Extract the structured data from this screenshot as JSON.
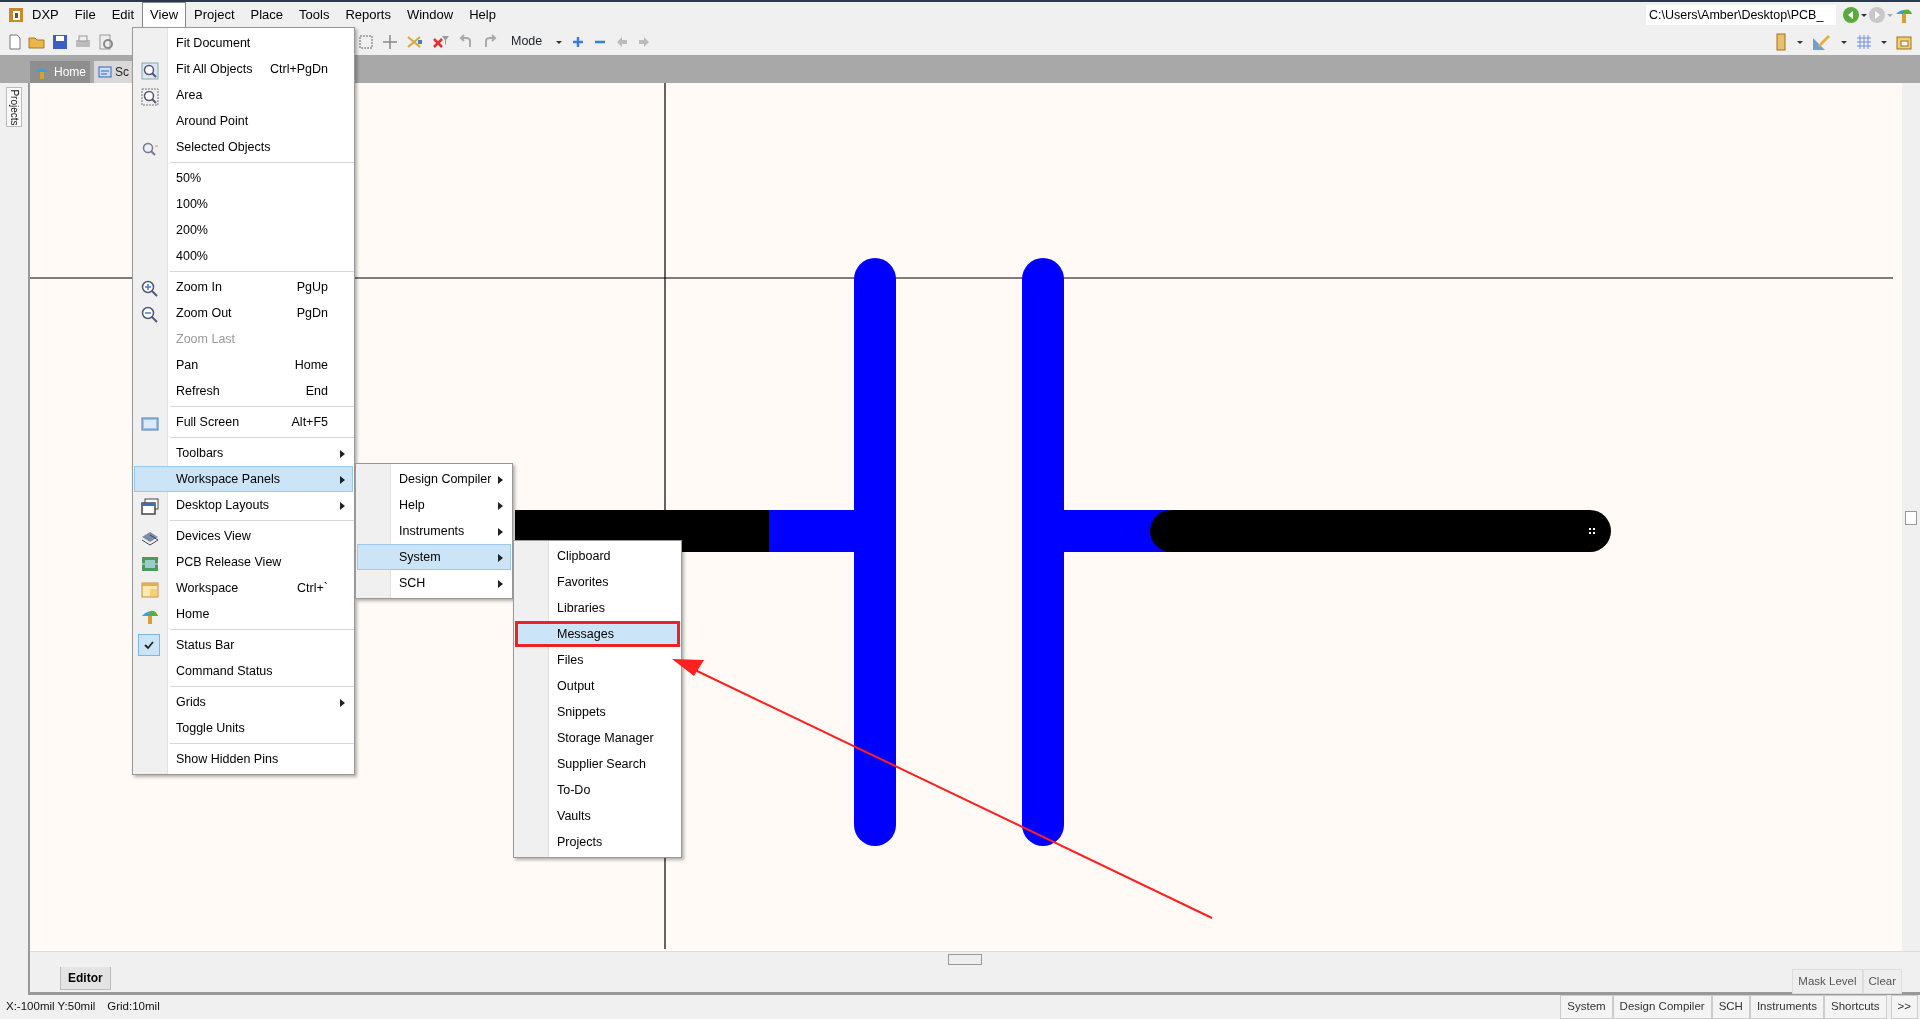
{
  "menubar": [
    {
      "label": "DXP",
      "selected": false
    },
    {
      "label": "File",
      "selected": false
    },
    {
      "label": "Edit",
      "selected": false
    },
    {
      "label": "View",
      "selected": true
    },
    {
      "label": "Project",
      "selected": false
    },
    {
      "label": "Place",
      "selected": false
    },
    {
      "label": "Tools",
      "selected": false
    },
    {
      "label": "Reports",
      "selected": false
    },
    {
      "label": "Window",
      "selected": false
    },
    {
      "label": "Help",
      "selected": false
    }
  ],
  "path_field": {
    "value": "C:\\Users\\Amber\\Desktop\\PCB_"
  },
  "toolbar": {
    "mode_label": "Mode"
  },
  "doc_tabs": [
    {
      "label": "Home",
      "selected": false
    },
    {
      "label": "Sc",
      "selected": true
    }
  ],
  "side_panel": {
    "label": "Projects"
  },
  "view_menu": {
    "items": [
      {
        "kind": "item",
        "label": "Fit Document",
        "selected": false,
        "disabled": false,
        "checked": false,
        "submenu": false
      },
      {
        "kind": "item",
        "label": "Fit All Objects",
        "shortcut": "Ctrl+PgDn",
        "selected": false,
        "disabled": false,
        "checked": false,
        "submenu": false
      },
      {
        "kind": "item",
        "label": "Area",
        "selected": false,
        "disabled": false,
        "checked": false,
        "submenu": false
      },
      {
        "kind": "item",
        "label": "Around Point",
        "selected": false,
        "disabled": false,
        "checked": false,
        "submenu": false
      },
      {
        "kind": "item",
        "label": "Selected Objects",
        "selected": false,
        "disabled": false,
        "checked": false,
        "submenu": false
      },
      {
        "kind": "separator"
      },
      {
        "kind": "item",
        "label": "50%",
        "selected": false,
        "disabled": false,
        "checked": false,
        "submenu": false
      },
      {
        "kind": "item",
        "label": "100%",
        "selected": false,
        "disabled": false,
        "checked": false,
        "submenu": false
      },
      {
        "kind": "item",
        "label": "200%",
        "selected": false,
        "disabled": false,
        "checked": false,
        "submenu": false
      },
      {
        "kind": "item",
        "label": "400%",
        "selected": false,
        "disabled": false,
        "checked": false,
        "submenu": false
      },
      {
        "kind": "separator"
      },
      {
        "kind": "item",
        "label": "Zoom In",
        "shortcut": "PgUp",
        "selected": false,
        "disabled": false,
        "checked": false,
        "submenu": false
      },
      {
        "kind": "item",
        "label": "Zoom Out",
        "shortcut": "PgDn",
        "selected": false,
        "disabled": false,
        "checked": false,
        "submenu": false
      },
      {
        "kind": "item",
        "label": "Zoom Last",
        "selected": false,
        "disabled": true,
        "checked": false,
        "submenu": false
      },
      {
        "kind": "item",
        "label": "Pan",
        "shortcut": "Home",
        "selected": false,
        "disabled": false,
        "checked": false,
        "submenu": false
      },
      {
        "kind": "item",
        "label": "Refresh",
        "shortcut": "End",
        "selected": false,
        "disabled": false,
        "checked": false,
        "submenu": false
      },
      {
        "kind": "separator"
      },
      {
        "kind": "item",
        "label": "Full Screen",
        "shortcut": "Alt+F5",
        "selected": false,
        "disabled": false,
        "checked": false,
        "submenu": false
      },
      {
        "kind": "separator"
      },
      {
        "kind": "item",
        "label": "Toolbars",
        "selected": false,
        "disabled": false,
        "checked": false,
        "submenu": true
      },
      {
        "kind": "item",
        "label": "Workspace Panels",
        "selected": true,
        "disabled": false,
        "checked": false,
        "submenu": true
      },
      {
        "kind": "item",
        "label": "Desktop Layouts",
        "selected": false,
        "disabled": false,
        "checked": false,
        "submenu": true
      },
      {
        "kind": "separator"
      },
      {
        "kind": "item",
        "label": "Devices View",
        "selected": false,
        "disabled": false,
        "checked": false,
        "submenu": false
      },
      {
        "kind": "item",
        "label": "PCB Release View",
        "selected": false,
        "disabled": false,
        "checked": false,
        "submenu": false
      },
      {
        "kind": "item",
        "label": "Workspace",
        "shortcut": "Ctrl+`",
        "selected": false,
        "disabled": false,
        "checked": false,
        "submenu": false
      },
      {
        "kind": "item",
        "label": "Home",
        "selected": false,
        "disabled": false,
        "checked": false,
        "submenu": false
      },
      {
        "kind": "separator"
      },
      {
        "kind": "item",
        "label": "Status Bar",
        "selected": false,
        "disabled": false,
        "checked": true,
        "submenu": false
      },
      {
        "kind": "item",
        "label": "Command Status",
        "selected": false,
        "disabled": false,
        "checked": false,
        "submenu": false
      },
      {
        "kind": "separator"
      },
      {
        "kind": "item",
        "label": "Grids",
        "selected": false,
        "disabled": false,
        "checked": false,
        "submenu": true
      },
      {
        "kind": "item",
        "label": "Toggle Units",
        "selected": false,
        "disabled": false,
        "checked": false,
        "submenu": false
      },
      {
        "kind": "separator"
      },
      {
        "kind": "item",
        "label": "Show Hidden Pins",
        "selected": false,
        "disabled": false,
        "checked": false,
        "submenu": false
      }
    ]
  },
  "panels_menu": {
    "items": [
      {
        "label": "Design Compiler",
        "selected": false,
        "submenu": true
      },
      {
        "label": "Help",
        "selected": false,
        "submenu": true
      },
      {
        "label": "Instruments",
        "selected": false,
        "submenu": true
      },
      {
        "label": "System",
        "selected": true,
        "submenu": true
      },
      {
        "label": "SCH",
        "selected": false,
        "submenu": true
      }
    ]
  },
  "system_menu": {
    "items": [
      {
        "label": "Clipboard",
        "selected": false,
        "boxed": false
      },
      {
        "label": "Favorites",
        "selected": false,
        "boxed": false
      },
      {
        "label": "Libraries",
        "selected": false,
        "boxed": false
      },
      {
        "label": "Messages",
        "selected": true,
        "boxed": true
      },
      {
        "label": "Files",
        "selected": false,
        "boxed": false
      },
      {
        "label": "Output",
        "selected": false,
        "boxed": false
      },
      {
        "label": "Snippets",
        "selected": false,
        "boxed": false
      },
      {
        "label": "Storage Manager",
        "selected": false,
        "boxed": false
      },
      {
        "label": "Supplier Search",
        "selected": false,
        "boxed": false
      },
      {
        "label": "To-Do",
        "selected": false,
        "boxed": false
      },
      {
        "label": "Vaults",
        "selected": false,
        "boxed": false
      },
      {
        "label": "Projects",
        "selected": false,
        "boxed": false
      }
    ]
  },
  "editor_tab": "Editor",
  "mask_buttons": [
    "Mask Level",
    "Clear"
  ],
  "status_bar": {
    "coords": "X:-100mil Y:50mil",
    "grid": "Grid:10mil"
  },
  "panel_buttons": [
    "System",
    "Design Compiler",
    "SCH",
    "Instruments",
    "Shortcuts",
    ">>"
  ]
}
